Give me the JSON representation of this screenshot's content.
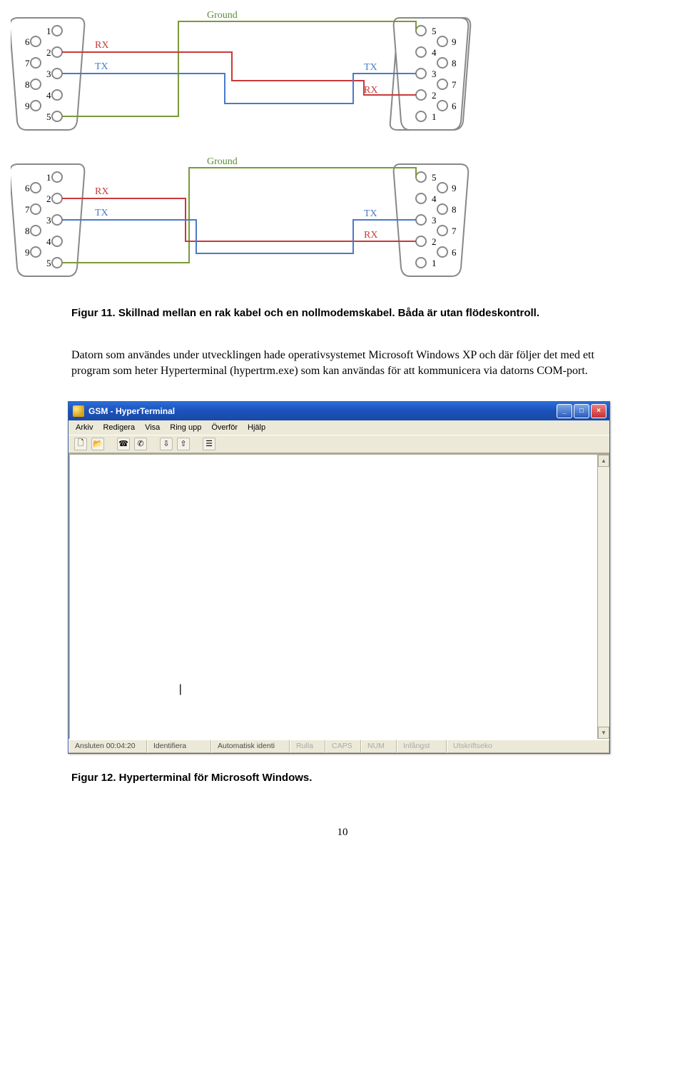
{
  "diagram1": {
    "left_connector_numbers": [
      "1",
      "6",
      "2",
      "7",
      "3",
      "8",
      "4",
      "9",
      "5"
    ],
    "right_connector_numbers": [
      "5",
      "9",
      "4",
      "8",
      "3",
      "7",
      "2",
      "6",
      "1"
    ],
    "labels": {
      "ground": "Ground",
      "rx_left": "RX",
      "tx_left": "TX",
      "tx_right": "TX",
      "rx_right": "RX"
    }
  },
  "diagram2": {
    "left_connector_numbers": [
      "1",
      "6",
      "2",
      "7",
      "3",
      "8",
      "4",
      "9",
      "5"
    ],
    "right_connector_numbers": [
      "5",
      "9",
      "4",
      "8",
      "3",
      "7",
      "2",
      "6",
      "1"
    ],
    "labels": {
      "ground": "Ground",
      "rx_left": "RX",
      "tx_left": "TX",
      "tx_right": "TX",
      "rx_right": "RX"
    }
  },
  "caption1": "Figur 11. Skillnad mellan en rak kabel och en nollmodemskabel. Båda är utan flödeskontroll.",
  "body_paragraph": "Datorn som användes under utvecklingen hade operativsystemet Microsoft Windows XP och där följer det med ett program som heter Hyperterminal (hypertrm.exe) som kan användas för att kommunicera via datorns COM-port.",
  "hyperterminal": {
    "title": "GSM - HyperTerminal",
    "menu": [
      "Arkiv",
      "Redigera",
      "Visa",
      "Ring upp",
      "Överför",
      "Hjälp"
    ],
    "cursor": "|",
    "status": {
      "connected": "Ansluten 00:04:20",
      "detect": "Identifiera",
      "autodetect": "Automatisk identi",
      "rulla": "Rulla",
      "caps": "CAPS",
      "num": "NUM",
      "infangst": "Infångst",
      "utskriftseko": "Utskriftseko"
    }
  },
  "caption2": "Figur 12. Hyperterminal för Microsoft Windows.",
  "page_number": "10",
  "colors": {
    "ground": "#7a9a3a",
    "rx": "#c83a3a",
    "tx": "#4a7ac8",
    "connector_stroke": "#888",
    "label": "#5a8a3a",
    "signal_label": "#4a7ac8"
  }
}
